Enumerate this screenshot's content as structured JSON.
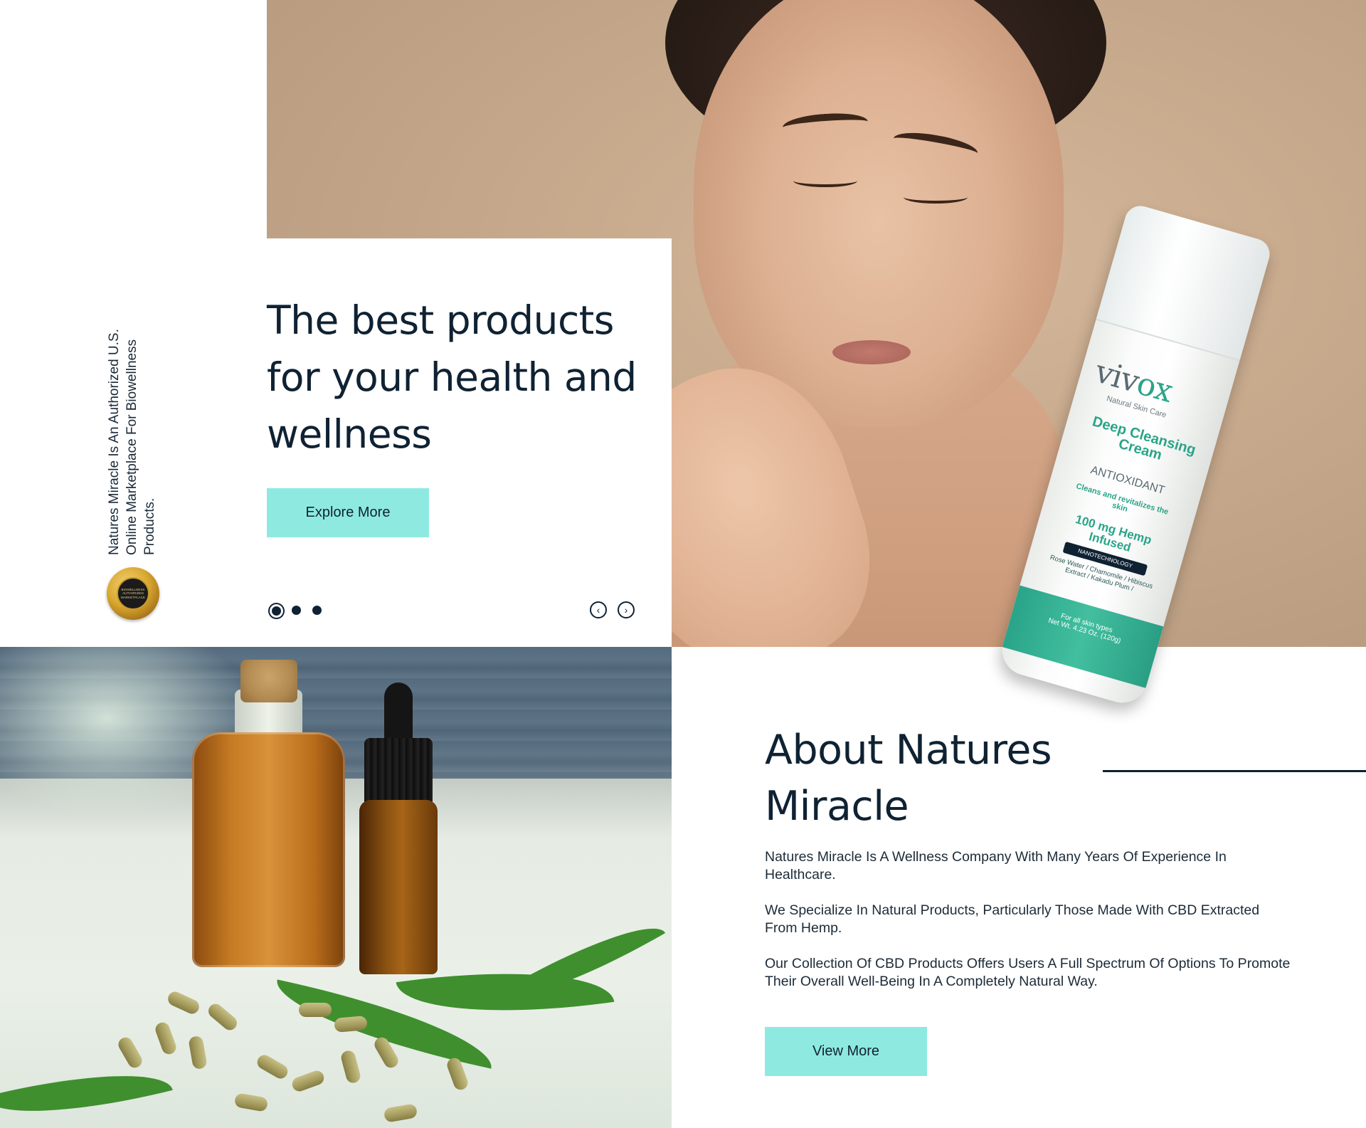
{
  "brand": {
    "tagline": "Natures Miracle Is An Authorized U.S. Online Marketplace For Biowellness Products.",
    "seal_text": "BIOWELLNESS AUTHORIZED MARKETPLACE"
  },
  "hero": {
    "title": "The best products for your health and wellness",
    "cta_label": "Explore More",
    "slides_count": 3,
    "active_slide": 1,
    "prev_icon": "chevron-left-circle-icon",
    "next_icon": "chevron-right-circle-icon"
  },
  "product": {
    "brand_prefix": "viv",
    "brand_suffix": "ox",
    "subtitle": "Natural Skin Care",
    "name": "Deep Cleansing Cream",
    "type": "ANTIOXIDANT",
    "claim": "Cleans and revitalizes the skin",
    "dose": "100 mg Hemp Infused",
    "tech": "NANOTECHNOLOGY",
    "ingredients": "Rose Water / Chamomile / Hibiscus Extract / Kakadu Plum /",
    "skin": "For all skin types",
    "net": "Net Wt. 4.23 Oz. (120g)"
  },
  "about": {
    "title": "About Natures Miracle",
    "paragraphs": [
      "Natures Miracle Is A Wellness Company With Many Years Of Experience In Healthcare.",
      "We Specialize In Natural Products, Particularly Those Made With CBD Extracted From Hemp.",
      "Our Collection Of CBD Products Offers Users A Full Spectrum Of Options To Promote Their Overall Well-Being In A Completely Natural Way."
    ],
    "cta_label": "View More"
  },
  "colors": {
    "accent": "#8eeae0",
    "text_dark": "#0f2233",
    "hero_bg": "#c8ad93"
  }
}
